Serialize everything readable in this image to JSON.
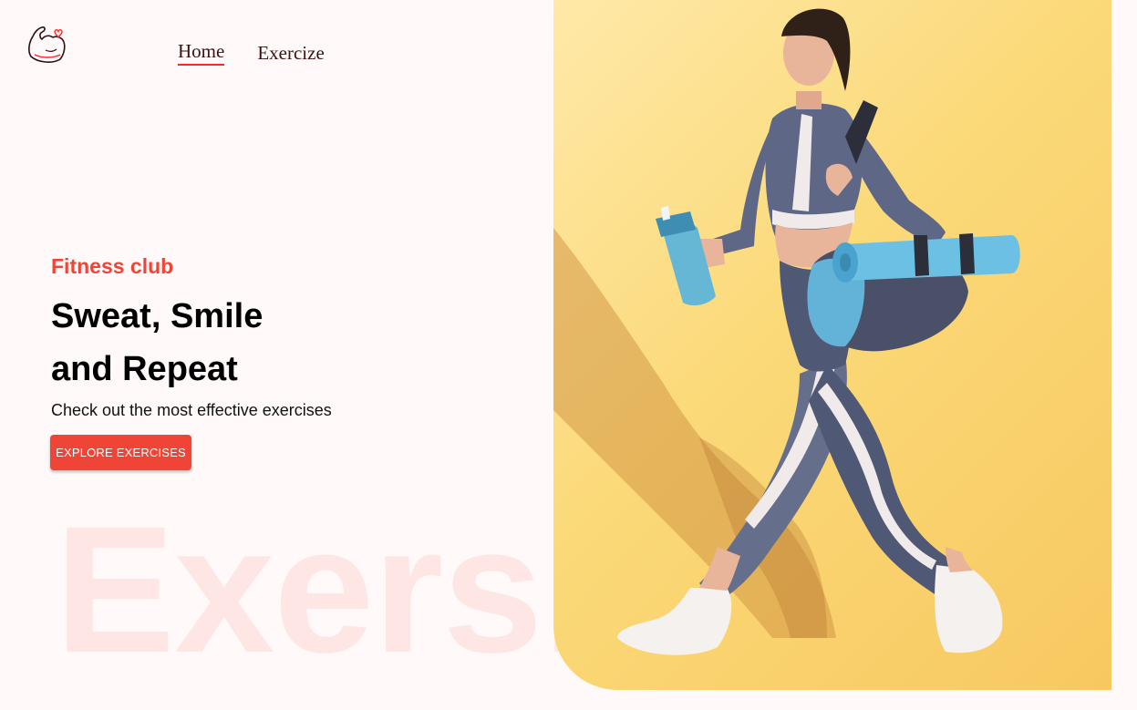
{
  "nav": {
    "home_label": "Home",
    "exercise_label": "Exercize"
  },
  "hero": {
    "kicker": "Fitness club",
    "headline_line1": "Sweat, Smile",
    "headline_line2": "and Repeat",
    "subtitle": "Check out the most effective exercises",
    "cta_label": "EXPLORE EXERCISES",
    "watermark": "Exersise"
  },
  "colors": {
    "accent": "#ef4537",
    "background": "#fff9f9",
    "banner_background": "#fbd978"
  },
  "icons": {
    "logo": "flexed-arm-heart-icon"
  }
}
